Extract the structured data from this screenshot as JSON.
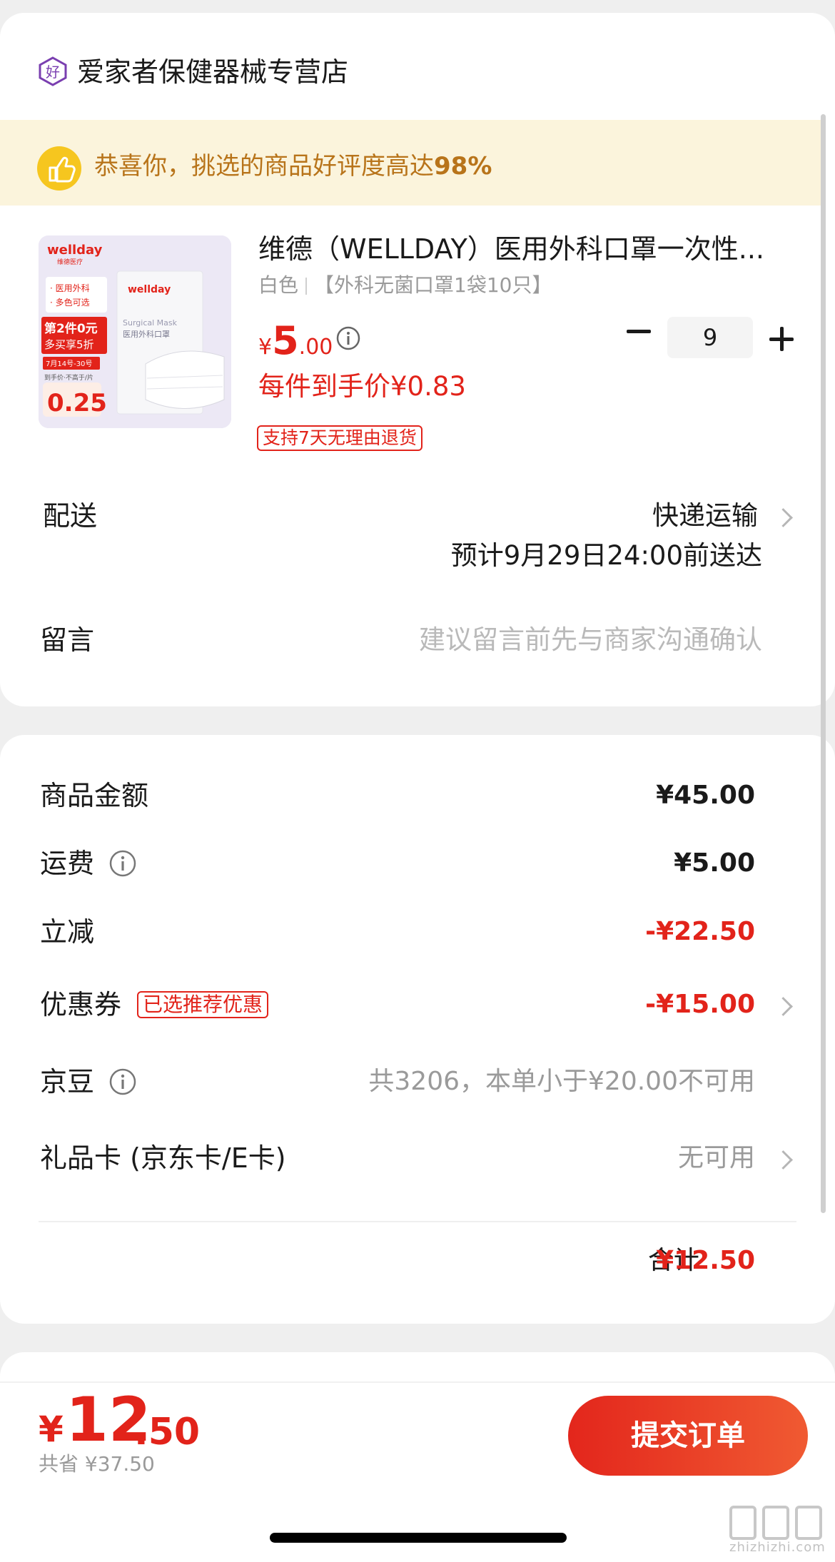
{
  "store": {
    "name": "爱家者保健器械专营店",
    "icon": "store-badge-icon"
  },
  "banner": {
    "prefix": "恭喜你，挑选的商品好评度高达",
    "rate": "98%",
    "icon": "thumbs-up-icon"
  },
  "product": {
    "title": "维德（WELLDAY）医用外科口罩一次性...",
    "color": "白色",
    "spec": "【外科无菌口罩1袋10只】",
    "price_yen": "¥",
    "price_int": "5",
    "price_dec": ".00",
    "quantity": "9",
    "unit_price": "每件到手价¥0.83",
    "return_tag": "支持7天无理由退货",
    "image": {
      "brand": "wellday",
      "brand_sub": "维德医疗",
      "tag1": "· 医用外科",
      "tag2": "· 多色可选",
      "promo1": "第2件0元",
      "promo2": "多买享5折",
      "date": "7月14号-30号",
      "note": "到手价·不高于/片",
      "price": "0.25",
      "pack_brand": "wellday",
      "pack_en": "Surgical Mask",
      "pack_cn": "医用外科口罩"
    }
  },
  "delivery": {
    "label": "配送",
    "method": "快递运输",
    "estimate": "预计9月29日24:00前送达"
  },
  "note": {
    "label": "留言",
    "placeholder": "建议留言前先与商家沟通确认"
  },
  "fees": {
    "goods_label": "商品金额",
    "goods_value": "¥45.00",
    "shipping_label": "运费",
    "shipping_value": "¥5.00",
    "discount_label": "立减",
    "discount_value": "-¥22.50",
    "coupon_label": "优惠券",
    "coupon_tag": "已选推荐优惠",
    "coupon_value": "-¥15.00",
    "beans_label": "京豆",
    "beans_value": "共3206，本单小于¥20.00不可用",
    "giftcard_label": "礼品卡 (京东卡/E卡)",
    "giftcard_value": "无可用",
    "total_label": "合计:",
    "total_value": "¥12.50"
  },
  "bottom": {
    "price_yen": "¥",
    "price_int": "12",
    "price_dec": ".50",
    "savings": "共省 ¥37.50",
    "submit_label": "提交订单"
  },
  "watermark": {
    "text": "zhizhizhi.com"
  },
  "colors": {
    "accent_red": "#e2231a",
    "banner_bg": "#fbf4dc",
    "banner_text": "#b8741a"
  }
}
